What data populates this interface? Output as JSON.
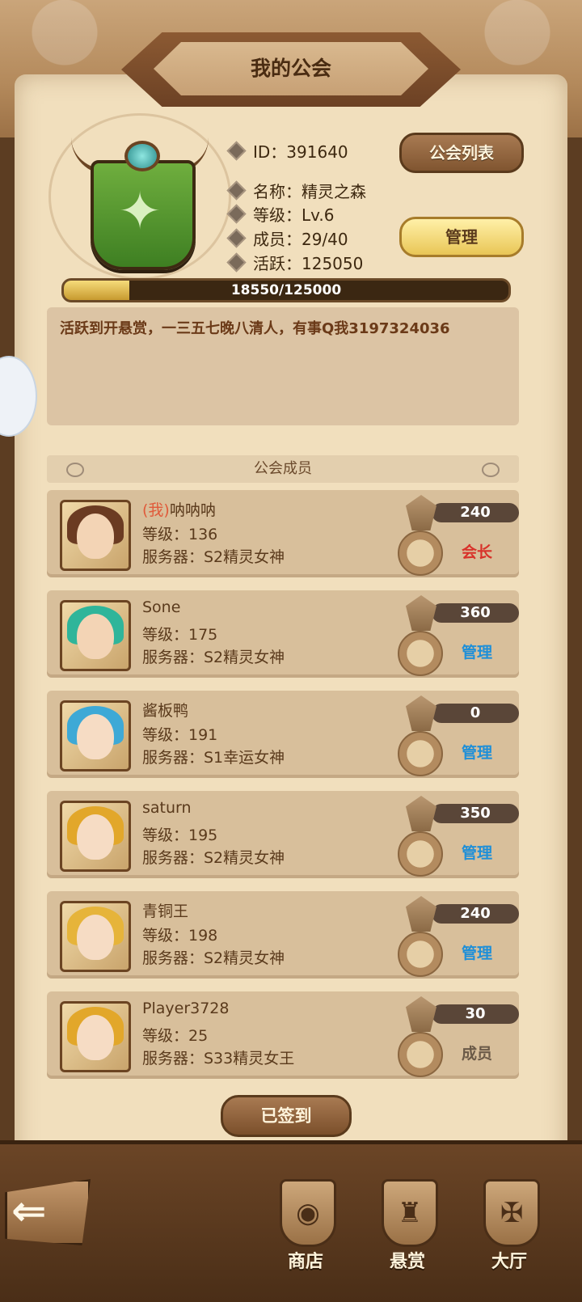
{
  "header": {
    "title": "我的公会"
  },
  "guild": {
    "id_label": "ID：391640",
    "name_label": "名称：精灵之森",
    "level_label": "等级：Lv.6",
    "members_label": "成员：29/40",
    "activity_label": "活跃：125050",
    "progress_text": "18550/125000",
    "progress_fraction": 0.148,
    "emblem_icon": "deer-icon"
  },
  "buttons": {
    "guild_list": "公会列表",
    "manage": "管理",
    "signed_in": "已签到"
  },
  "notice": "活跃到开悬赏，一三五七晚八清人，有事Q我3197324036",
  "members_section": {
    "title": "公会成员"
  },
  "members": [
    {
      "me_tag": "(我)",
      "name": "呐呐呐",
      "level": "等级：136",
      "server": "服务器：S2精灵女神",
      "score": "240",
      "role": "会长",
      "role_color": "#d8322a",
      "hair": "#6b3b22",
      "face": "#f3d4b5"
    },
    {
      "me_tag": "",
      "name": "Sone",
      "level": "等级：175",
      "server": "服务器：S2精灵女神",
      "score": "360",
      "role": "管理",
      "role_color": "#1e8fd8",
      "hair": "#2fb59a",
      "face": "#f3d4b5"
    },
    {
      "me_tag": "",
      "name": "酱板鸭",
      "level": "等级：191",
      "server": "服务器：S1幸运女神",
      "score": "0",
      "role": "管理",
      "role_color": "#1e8fd8",
      "hair": "#3ea9d6",
      "face": "#f6dcc4"
    },
    {
      "me_tag": "",
      "name": "saturn",
      "level": "等级：195",
      "server": "服务器：S2精灵女神",
      "score": "350",
      "role": "管理",
      "role_color": "#1e8fd8",
      "hair": "#e2a72a",
      "face": "#f6dcc4"
    },
    {
      "me_tag": "",
      "name": "青铜王",
      "level": "等级：198",
      "server": "服务器：S2精灵女神",
      "score": "240",
      "role": "管理",
      "role_color": "#1e8fd8",
      "hair": "#e6b43a",
      "face": "#f6dcc4"
    },
    {
      "me_tag": "",
      "name": "Player3728",
      "level": "等级：25",
      "server": "服务器：S33精灵女王",
      "score": "30",
      "role": "成员",
      "role_color": "#6b5a48",
      "hair": "#e2a72a",
      "face": "#f6dcc4"
    }
  ],
  "nav": [
    {
      "label": "商店",
      "icon": "shop-bag-icon"
    },
    {
      "label": "悬赏",
      "icon": "bounty-helmet-icon"
    },
    {
      "label": "大厅",
      "icon": "hall-banner-icon"
    }
  ]
}
